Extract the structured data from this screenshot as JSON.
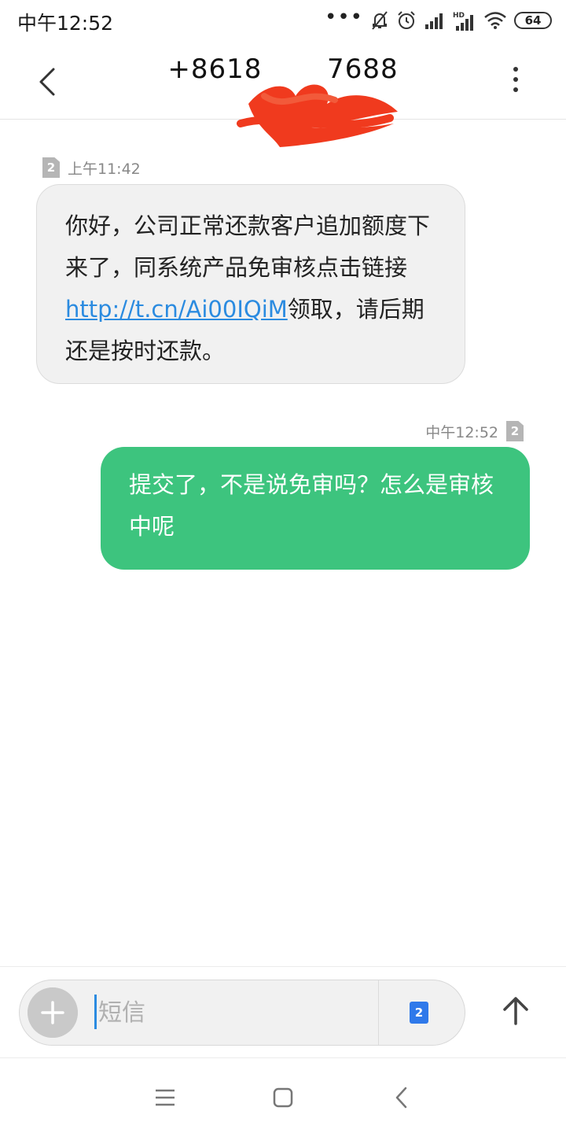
{
  "status_bar": {
    "time": "中午12:52",
    "battery": "64"
  },
  "header": {
    "contact_number": "+8618       7688"
  },
  "messages": [
    {
      "direction": "incoming",
      "time": "上午11:42",
      "sim": "2",
      "text_before": "你好，公司正常还款客户追加额度下来了，同系统产品免审核点击链接 ",
      "link": "http://t.cn/Ai00IQiM",
      "text_after": "领取，请后期还是按时还款。"
    },
    {
      "direction": "outgoing",
      "time": "中午12:52",
      "sim": "2",
      "text": "提交了，不是说免审吗？怎么是审核中呢"
    }
  ],
  "composer": {
    "placeholder": "短信",
    "sim": "2"
  },
  "colors": {
    "outgoing_bubble": "#3dc47e",
    "link": "#2b8be0",
    "sim_select": "#2f79ea",
    "redaction": "#f03a1e"
  }
}
